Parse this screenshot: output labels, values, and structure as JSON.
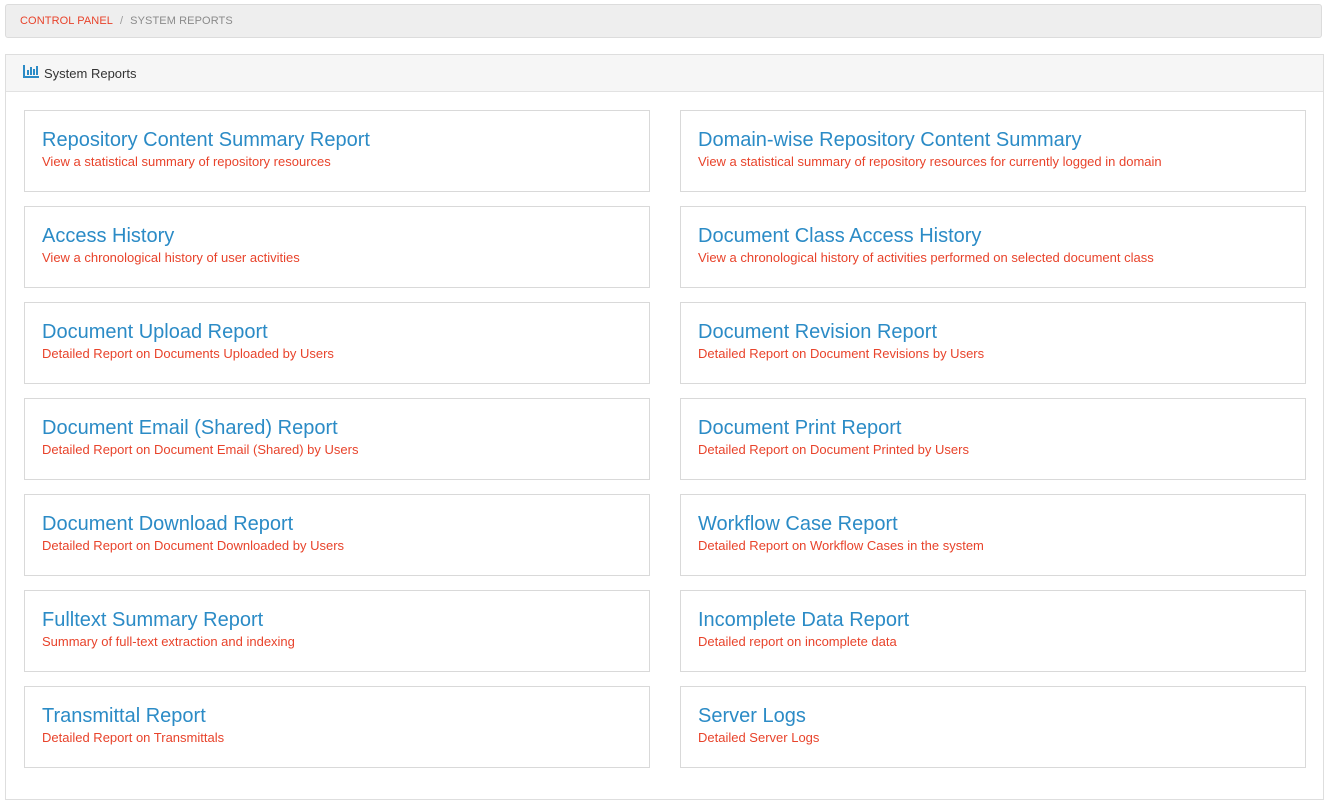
{
  "breadcrumb": {
    "root": "CONTROL PANEL",
    "separator": "/",
    "current": "SYSTEM REPORTS"
  },
  "panel": {
    "icon": "bar-chart-icon",
    "title": "System Reports"
  },
  "colors": {
    "accent_red": "#e8432b",
    "title_blue": "#2b8bc6"
  },
  "reports": [
    {
      "title": "Repository Content Summary Report",
      "description": "View a statistical summary of repository resources"
    },
    {
      "title": "Domain-wise Repository Content Summary",
      "description": "View a statistical summary of repository resources for currently logged in domain"
    },
    {
      "title": "Access History",
      "description": "View a chronological history of user activities"
    },
    {
      "title": "Document Class Access History",
      "description": "View a chronological history of activities performed on selected document class"
    },
    {
      "title": "Document Upload Report",
      "description": "Detailed Report on Documents Uploaded by Users"
    },
    {
      "title": "Document Revision Report",
      "description": "Detailed Report on Document Revisions by Users"
    },
    {
      "title": "Document Email (Shared) Report",
      "description": "Detailed Report on Document Email (Shared) by Users"
    },
    {
      "title": "Document Print Report",
      "description": "Detailed Report on Document Printed by Users"
    },
    {
      "title": "Document Download Report",
      "description": "Detailed Report on Document Downloaded by Users"
    },
    {
      "title": "Workflow Case Report",
      "description": "Detailed Report on Workflow Cases in the system"
    },
    {
      "title": "Fulltext Summary Report",
      "description": "Summary of full-text extraction and indexing"
    },
    {
      "title": "Incomplete Data Report",
      "description": "Detailed report on incomplete data"
    },
    {
      "title": "Transmittal Report",
      "description": "Detailed Report on Transmittals"
    },
    {
      "title": "Server Logs",
      "description": "Detailed Server Logs"
    }
  ]
}
